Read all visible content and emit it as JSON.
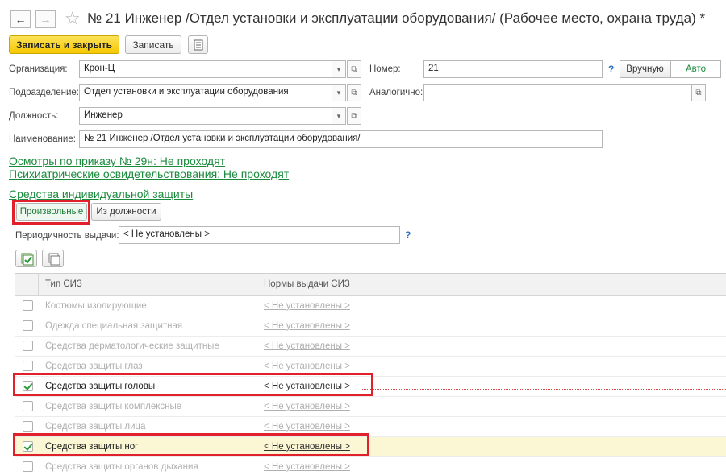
{
  "window": {
    "title": "№ 21 Инженер /Отдел установки и эксплуатации оборудования/ (Рабочее место, охрана труда) *"
  },
  "toolbar": {
    "save_close_label": "Записать и закрыть",
    "save_label": "Записать"
  },
  "form": {
    "org_label": "Организация:",
    "org_value": "Крон-Ц",
    "number_label": "Номер:",
    "number_value": "21",
    "number_mode_manual": "Вручную",
    "number_mode_auto": "Авто",
    "dept_label": "Подразделение:",
    "dept_value": "Отдел установки и эксплуатации оборудования",
    "similar_label": "Аналогично:",
    "similar_value": "",
    "position_label": "Должность:",
    "position_value": "Инженер",
    "name_label": "Наименование:",
    "name_value": "№ 21 Инженер /Отдел установки и эксплуатации оборудования/",
    "help_mark": "?"
  },
  "links": {
    "exams": "Осмотры по приказу № 29н: Не проходят",
    "psych": "Психиатрические освидетельствования: Не проходят"
  },
  "siz": {
    "section_title": "Средства индивидуальной защиты",
    "tabs": [
      "Произвольные",
      "Из должности"
    ],
    "period_label": "Периодичность выдачи:",
    "period_value": "< Не установлены >",
    "help_mark": "?",
    "table": {
      "col_type": "Тип СИЗ",
      "col_norms": "Нормы выдачи СИЗ",
      "rows": [
        {
          "name": "Костюмы изолирующие",
          "norm": "< Не установлены >",
          "checked": false
        },
        {
          "name": "Одежда специальная защитная",
          "norm": "< Не установлены >",
          "checked": false
        },
        {
          "name": "Средства дерматологические защитные",
          "norm": "< Не установлены >",
          "checked": false
        },
        {
          "name": "Средства защиты глаз",
          "norm": "< Не установлены >",
          "checked": false
        },
        {
          "name": "Средства защиты головы",
          "norm": "< Не установлены >",
          "checked": true
        },
        {
          "name": "Средства защиты комплексные",
          "norm": "< Не установлены >",
          "checked": false
        },
        {
          "name": "Средства защиты лица",
          "norm": "< Не установлены >",
          "checked": false
        },
        {
          "name": "Средства защиты ног",
          "norm": "< Не установлены >",
          "checked": true
        },
        {
          "name": "Средства защиты органов дыхания",
          "norm": "< Не установлены >",
          "checked": false
        }
      ]
    }
  },
  "colors": {
    "accent_green": "#1a8a3c",
    "primary_button": "#f5c800",
    "highlight_red": "#e0202a",
    "selected_row": "#fbf6d4"
  }
}
